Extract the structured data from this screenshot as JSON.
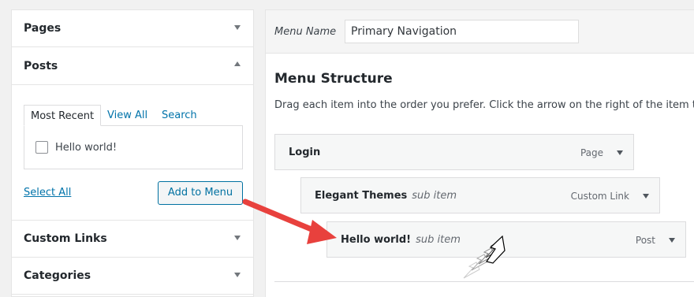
{
  "sidebar": {
    "sections": [
      {
        "title": "Pages",
        "state": "collapsed"
      },
      {
        "title": "Posts",
        "state": "expanded"
      },
      {
        "title": "Custom Links",
        "state": "collapsed"
      },
      {
        "title": "Categories",
        "state": "collapsed"
      }
    ],
    "posts": {
      "tabs": [
        "Most Recent",
        "View All",
        "Search"
      ],
      "active_tab": "Most Recent",
      "items": [
        {
          "label": "Hello world!",
          "checked": false
        }
      ],
      "select_all": "Select All",
      "add_button": "Add to Menu"
    }
  },
  "menu": {
    "name_label": "Menu Name",
    "name_value": "Primary Navigation",
    "structure_title": "Menu Structure",
    "instructions": "Drag each item into the order you prefer. Click the arrow on the right of the item to r",
    "items": [
      {
        "title": "Login",
        "sub": "",
        "type": "Page"
      },
      {
        "title": "Elegant Themes",
        "sub": "sub item",
        "type": "Custom Link"
      },
      {
        "title": "Hello world!",
        "sub": "sub item",
        "type": "Post"
      }
    ]
  },
  "colors": {
    "link": "#0073aa",
    "annotation_arrow": "#e8413d",
    "panel_bg": "#f1f1f1"
  }
}
